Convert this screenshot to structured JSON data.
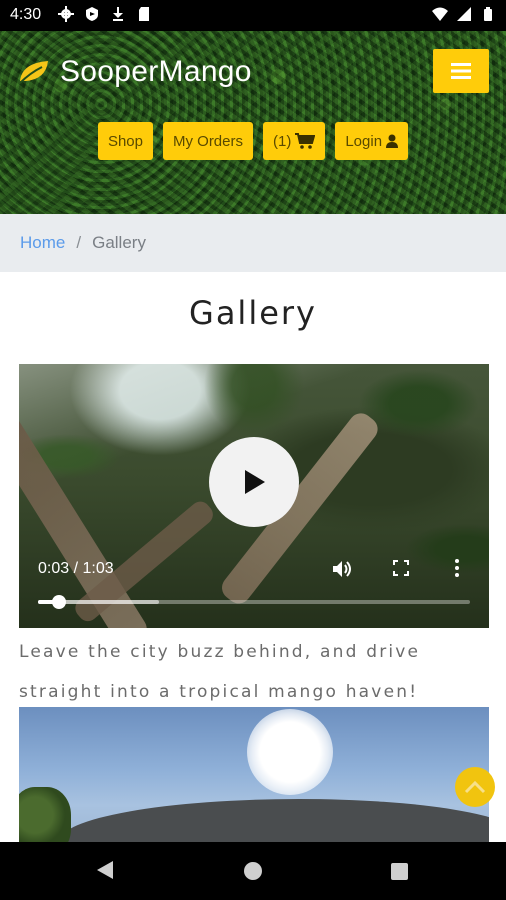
{
  "status_bar": {
    "time": "4:30",
    "left_icons": [
      "settings-icon",
      "shield-icon",
      "download-icon",
      "sd-card-icon"
    ],
    "right_icons": [
      "wifi-icon",
      "signal-icon",
      "battery-icon"
    ]
  },
  "header": {
    "brand": "SooperMango",
    "brand_icon": "leaf-icon",
    "accent": "#ffcc0a",
    "menu_icon": "hamburger-icon",
    "nav": {
      "shop": "Shop",
      "orders": "My Orders",
      "cart_count": "(1)",
      "login": "Login"
    }
  },
  "breadcrumb": {
    "home": "Home",
    "separator": "/",
    "current": "Gallery"
  },
  "page": {
    "title": "Gallery"
  },
  "video": {
    "time": "0:03 / 1:03",
    "progress": 0.048,
    "buffered": 0.28,
    "controls": [
      "play-icon",
      "volume-icon",
      "fullscreen-icon",
      "more-vert-icon"
    ]
  },
  "caption": "Leave the city buzz behind, and drive straight into a tropical mango haven!",
  "scroll_top_icon": "chevron-up-icon",
  "system_nav": [
    "back-icon",
    "home-icon",
    "recents-icon"
  ]
}
